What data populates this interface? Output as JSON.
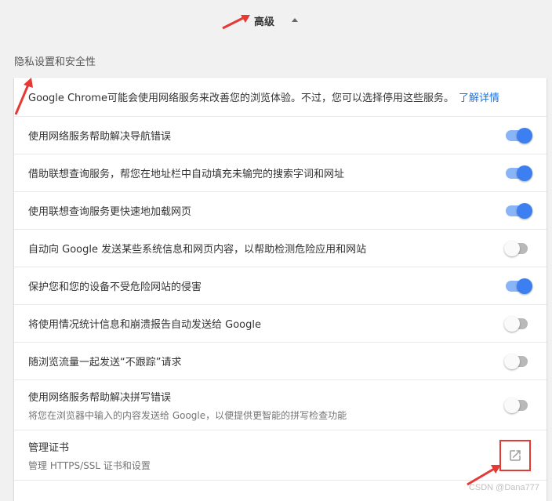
{
  "header": {
    "title": "高级"
  },
  "section": {
    "title": "隐私设置和安全性"
  },
  "intro": {
    "text": "Google Chrome可能会使用网络服务来改善您的浏览体验。不过，您可以选择停用这些服务。",
    "link": "了解详情"
  },
  "settings": [
    {
      "label": "使用网络服务帮助解决导航错误",
      "state": "on"
    },
    {
      "label": "借助联想查询服务，帮您在地址栏中自动填充未输完的搜索字词和网址",
      "state": "on"
    },
    {
      "label": "使用联想查询服务更快速地加载网页",
      "state": "on"
    },
    {
      "label": "自动向 Google 发送某些系统信息和网页内容，以帮助检测危险应用和网站",
      "state": "off"
    },
    {
      "label": "保护您和您的设备不受危险网站的侵害",
      "state": "on"
    },
    {
      "label": "将使用情况统计信息和崩溃报告自动发送给 Google",
      "state": "off"
    },
    {
      "label": "随浏览流量一起发送“不跟踪”请求",
      "state": "off"
    }
  ],
  "spellcheck": {
    "label": "使用网络服务帮助解决拼写错误",
    "sublabel": "将您在浏览器中输入的内容发送给 Google，以便提供更智能的拼写检查功能",
    "state": "off"
  },
  "certificates": {
    "label": "管理证书",
    "sublabel": "管理 HTTPS/SSL 证书和设置"
  },
  "watermark": "CSDN @Dana777",
  "colors": {
    "toggle_on": "#3d7ff0",
    "link": "#1a73e8",
    "annotation": "#e53935"
  }
}
